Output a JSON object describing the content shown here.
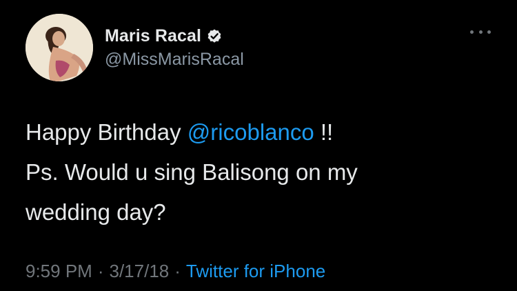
{
  "user": {
    "display_name": "Maris Racal",
    "handle": "@MissMarisRacal"
  },
  "tweet": {
    "line1_prefix": "Happy Birthday ",
    "mention": "@ricoblanco",
    "line1_suffix": " !!",
    "line2": "Ps. Would u sing Balisong on my",
    "line3": "wedding day?"
  },
  "meta": {
    "time": "9:59 PM",
    "date": "3/17/18",
    "separator": "·",
    "source": "Twitter for iPhone"
  },
  "icons": {
    "verified": "verified-badge-icon",
    "more": "more-options-icon"
  },
  "colors": {
    "background": "#000000",
    "text": "#e7e9ea",
    "secondary": "#71767b",
    "link": "#1d9bf0"
  }
}
